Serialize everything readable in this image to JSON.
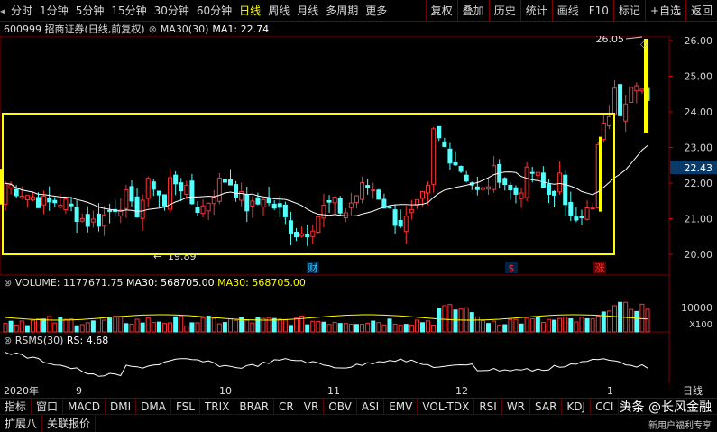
{
  "toolbar": {
    "periods": [
      "分时",
      "1分钟",
      "5分钟",
      "15分钟",
      "30分钟",
      "60分钟",
      "日线",
      "周线",
      "月线",
      "多周期",
      "更多"
    ],
    "active_period": "日线",
    "tools": [
      "复权",
      "叠加",
      "历史",
      "统计",
      "画线",
      "F10",
      "标记",
      "+自选",
      "返回"
    ]
  },
  "info": {
    "code_name": "600999 招商证券(日线,前复权)",
    "ma_label": "MA30(30)",
    "ma1": "MA1: 22.74"
  },
  "price_axis": [
    "26.00",
    "25.00",
    "24.00",
    "23.00",
    "22.00",
    "21.00",
    "20.00"
  ],
  "current_price": "22.43",
  "annot": {
    "high": "26.05",
    "low": "19.89"
  },
  "markers": [
    "财",
    "$",
    "涨"
  ],
  "volume": {
    "label": "VOLUME: 1177671.75",
    "ma": "MA30: 568705.00",
    "ma2": "MA30: 568705.00",
    "axis": [
      "10000",
      "X100"
    ]
  },
  "rsms": {
    "label": "RSMS(30)",
    "value": "RS: 4.68"
  },
  "dates": [
    "2020年",
    "9",
    "10",
    "11",
    "12",
    "1"
  ],
  "axis_type": "日线",
  "indicators": [
    "指标",
    "窗口",
    "MACD",
    "DMI",
    "DMA",
    "FSL",
    "TRIX",
    "BRAR",
    "CR",
    "VR",
    "OBV",
    "ASI",
    "EMV",
    "VOL-TDX",
    "RSI",
    "WR",
    "SAR",
    "KDJ",
    "CCI",
    "R"
  ],
  "bottom": [
    "扩展八",
    "关联报价"
  ],
  "watermark": {
    "main": "头条 @长风金融",
    "sub": "新用户福利专享"
  },
  "colors": {
    "up": "#ff3232",
    "down": "#54ffff",
    "ma": "#ffffff",
    "box": "#ffff00",
    "grid": "#800000"
  }
}
